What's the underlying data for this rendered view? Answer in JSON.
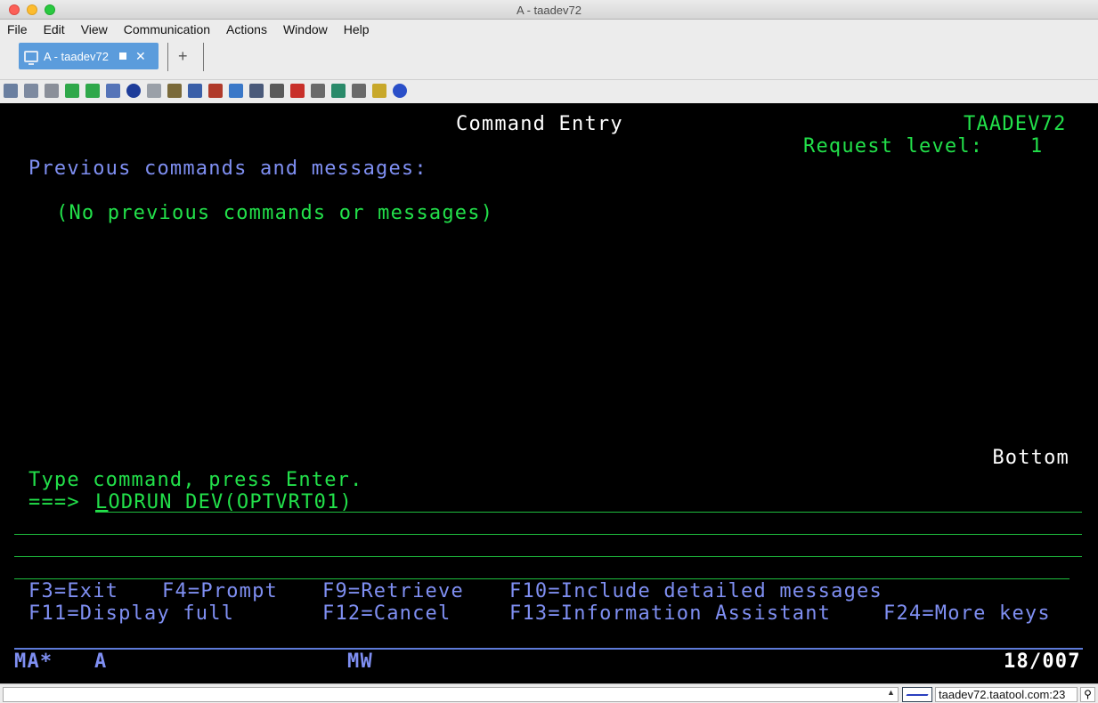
{
  "window": {
    "title": "A - taadev72"
  },
  "menu": [
    "File",
    "Edit",
    "View",
    "Communication",
    "Actions",
    "Window",
    "Help"
  ],
  "tab": {
    "label": "A - taadev72",
    "close": "✕",
    "new_tab": "+"
  },
  "toolbar": {
    "icons": [
      "copy-icon",
      "cut-icon",
      "paste-icon",
      "send-icon",
      "receive-icon",
      "data-transfer-icon",
      "navigate-icon",
      "print-icon",
      "macro-icon",
      "settings-icon",
      "keypad-icon",
      "display-icon",
      "keyboard-icon",
      "tools-icon",
      "record-icon",
      "stop-icon",
      "play-icon",
      "pause-icon",
      "notes-icon",
      "help-icon"
    ]
  },
  "terminal": {
    "title": "Command Entry",
    "system": "TAADEV72",
    "request_level_label": "Request level:",
    "request_level_value": "1",
    "prev_header": "Previous commands and messages:",
    "no_prev": "(No previous commands or messages)",
    "bottom": "Bottom",
    "instruction": "Type command, press Enter.",
    "prompt": "===>",
    "command_first": "L",
    "command_rest": "ODRUN DEV(OPTVRT01)",
    "fkeys_row1": [
      "F3=Exit",
      "F4=Prompt",
      "F9=Retrieve",
      "F10=Include detailed messages"
    ],
    "fkeys_row2": [
      "F11=Display full",
      "F12=Cancel",
      "F13=Information Assistant",
      "F24=More keys"
    ]
  },
  "oia": {
    "status": "MA*",
    "session": "A",
    "mode": "MW",
    "cursor_pos": "18/007"
  },
  "statusbar": {
    "host": "taadev72.taatool.com:23"
  },
  "colors": {
    "screen_bg": "#000000",
    "green": "#22e04a",
    "blue": "#7f8ff2",
    "white": "#ffffff",
    "tab": "#5b9cdc"
  }
}
